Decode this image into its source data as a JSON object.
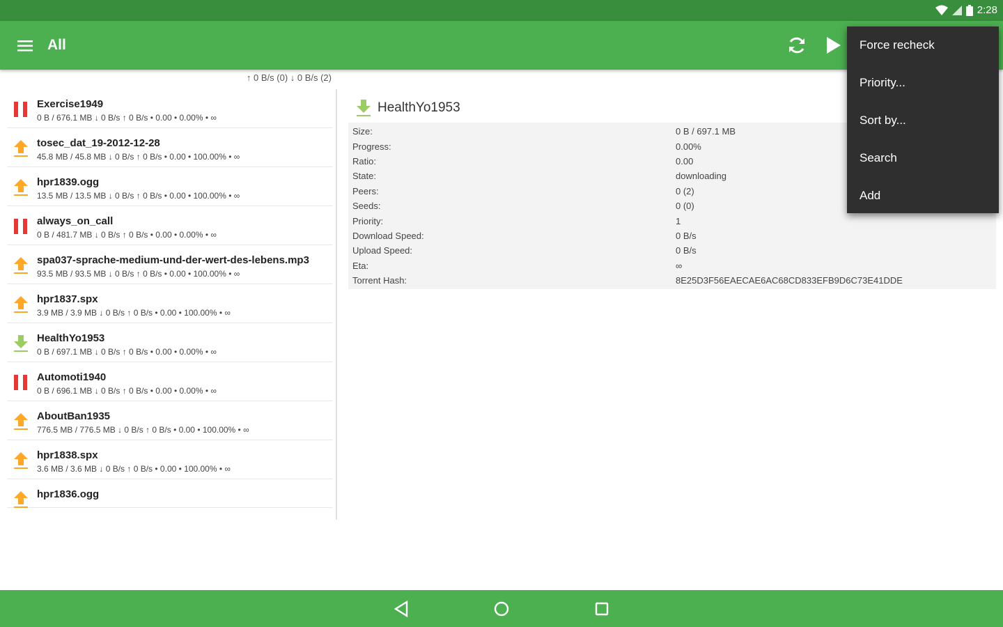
{
  "status_bar": {
    "time": "2:28"
  },
  "toolbar": {
    "title": "All",
    "actions": [
      "refresh-icon",
      "play-icon"
    ]
  },
  "speed_summary": "↑ 0 B/s (0) ↓ 0 B/s (2)",
  "colors": {
    "primary": "#4caf50",
    "primary_dark": "#388e3c",
    "paused": "#e53935",
    "upload": "#ffa726",
    "download": "#9ccc65",
    "popup_bg": "#2f2f2f"
  },
  "torrents": [
    {
      "name": "Exercise1949",
      "info": "0 B / 676.1 MB ↓ 0 B/s ↑ 0 B/s • 0.00 • 0.00% • ∞",
      "state": "paused"
    },
    {
      "name": "tosec_dat_19-2012-12-28",
      "info": "45.8 MB / 45.8 MB ↓ 0 B/s ↑ 0 B/s • 0.00 • 100.00% • ∞",
      "state": "seeding"
    },
    {
      "name": "hpr1839.ogg",
      "info": "13.5 MB / 13.5 MB ↓ 0 B/s ↑ 0 B/s • 0.00 • 100.00% • ∞",
      "state": "seeding"
    },
    {
      "name": "always_on_call",
      "info": "0 B / 481.7 MB ↓ 0 B/s ↑ 0 B/s • 0.00 • 0.00% • ∞",
      "state": "paused"
    },
    {
      "name": "spa037-sprache-medium-und-der-wert-des-lebens.mp3",
      "info": "93.5 MB / 93.5 MB ↓ 0 B/s ↑ 0 B/s • 0.00 • 100.00% • ∞",
      "state": "seeding"
    },
    {
      "name": "hpr1837.spx",
      "info": "3.9 MB / 3.9 MB ↓ 0 B/s ↑ 0 B/s • 0.00 • 100.00% • ∞",
      "state": "seeding"
    },
    {
      "name": "HealthYo1953",
      "info": "0 B / 697.1 MB ↓ 0 B/s ↑ 0 B/s • 0.00 • 0.00% • ∞",
      "state": "downloading"
    },
    {
      "name": "Automoti1940",
      "info": "0 B / 696.1 MB ↓ 0 B/s ↑ 0 B/s • 0.00 • 0.00% • ∞",
      "state": "paused"
    },
    {
      "name": "AboutBan1935",
      "info": "776.5 MB / 776.5 MB ↓ 0 B/s ↑ 0 B/s • 0.00 • 100.00% • ∞",
      "state": "seeding"
    },
    {
      "name": "hpr1838.spx",
      "info": "3.6 MB / 3.6 MB ↓ 0 B/s ↑ 0 B/s • 0.00 • 100.00% • ∞",
      "state": "seeding"
    },
    {
      "name": "hpr1836.ogg",
      "info": "",
      "state": "seeding"
    }
  ],
  "detail": {
    "title": "HealthYo1953",
    "state_icon": "download-arrow-icon",
    "fields": [
      {
        "label": "Size:",
        "value": "0 B / 697.1 MB"
      },
      {
        "label": "Progress:",
        "value": "0.00%"
      },
      {
        "label": "Ratio:",
        "value": "0.00"
      },
      {
        "label": "State:",
        "value": "downloading"
      },
      {
        "label": "Peers:",
        "value": "0 (2)"
      },
      {
        "label": "Seeds:",
        "value": "0 (0)"
      },
      {
        "label": "Priority:",
        "value": "1"
      },
      {
        "label": "Download Speed:",
        "value": "0 B/s"
      },
      {
        "label": "Upload Speed:",
        "value": "0 B/s"
      },
      {
        "label": "Eta:",
        "value": "∞"
      },
      {
        "label": "Torrent Hash:",
        "value": "8E25D3F56EAECAE6AC68CD833EFB9D6C73E41DDE"
      }
    ]
  },
  "overflow_menu": {
    "items": [
      "Force recheck",
      "Priority...",
      "Sort by...",
      "Search",
      "Add"
    ]
  }
}
